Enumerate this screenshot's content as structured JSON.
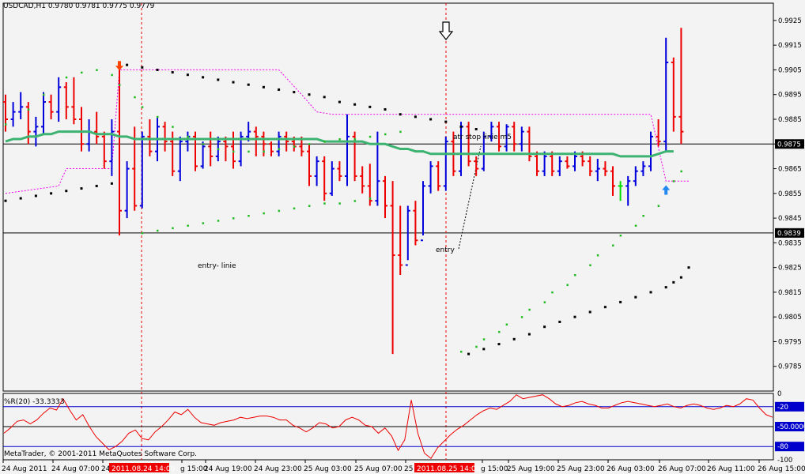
{
  "colors": {
    "background": "#f3f3f3",
    "bull_bar": "#0000dd",
    "bear_bar": "#ee0000",
    "doji_bar": "#00dd00",
    "moving_average": "#3cb371",
    "psar_green": "#22bb22",
    "psar_black": "#000000",
    "atr_stop": "#ee00ee",
    "wpr_line": "#ee0000",
    "wpr_levels": "#0000cc",
    "price_marker_bg": "#000000",
    "time_marker_bg": "#ee0000",
    "up_arrow": "#2288ee",
    "down_arrow": "#ff4400"
  },
  "header": {
    "symbol_info": "USDCAD,H1  0.9780 0.9781 0.9775 0.9779"
  },
  "annotations": {
    "atr_label": "atr stop linie m5",
    "entry_line_label": "entry- linie",
    "entry_label": "entry"
  },
  "indicator": {
    "label": "%R(20) -33.3333"
  },
  "footer": {
    "copyright": "MetaTrader, © 2001-2011 MetaQuotes Software Corp."
  },
  "price_axis": {
    "ticks": [
      "0.9925",
      "0.9915",
      "0.9905",
      "0.9895",
      "0.9885",
      "0.9875",
      "0.9865",
      "0.9855",
      "0.9845",
      "0.9835",
      "0.9825",
      "0.9815",
      "0.9805",
      "0.9795",
      "0.9785"
    ],
    "markers": [
      "0.9875",
      "0.9839"
    ]
  },
  "indicator_axis": {
    "ticks": [
      "0",
      "-20",
      "-50.0000",
      "-80",
      "-100"
    ],
    "markers": [
      "-20",
      "-50.0000",
      "-80"
    ]
  },
  "time_axis": {
    "labels": [
      "24 Aug 2011",
      "24 Aug 07:00",
      "24",
      "g 15:00",
      "24 Aug 19:00",
      "24 Aug 23:00",
      "25 Aug 03:00",
      "25 Aug 07:00",
      "25",
      "g 15:00",
      "25 Aug 19:00",
      "25 Aug 23:00",
      "26 Aug 03:00",
      "26 Aug 07:00",
      "26 Aug 11:00",
      "26 Aug 15:00"
    ],
    "highlighted": [
      "2011.08.24 14:00",
      "2011.08.25 14:00"
    ]
  },
  "chart_data": {
    "type": "bar",
    "symbol": "USDCAD",
    "timeframe": "H1",
    "ylim": [
      0.9775,
      0.9932
    ],
    "horizontal_lines": [
      0.9875,
      0.9839
    ],
    "candles": [
      [
        0.9892,
        0.9895,
        0.988,
        0.9885
      ],
      [
        0.9885,
        0.9892,
        0.9882,
        0.9888
      ],
      [
        0.9888,
        0.9896,
        0.9885,
        0.989
      ],
      [
        0.989,
        0.9892,
        0.9875,
        0.988
      ],
      [
        0.988,
        0.9886,
        0.9874,
        0.9882
      ],
      [
        0.9882,
        0.9896,
        0.9879,
        0.9892
      ],
      [
        0.9892,
        0.9895,
        0.9885,
        0.9888
      ],
      [
        0.9888,
        0.9902,
        0.9884,
        0.9898
      ],
      [
        0.9898,
        0.99,
        0.9885,
        0.989
      ],
      [
        0.989,
        0.9902,
        0.9883,
        0.9885
      ],
      [
        0.9885,
        0.989,
        0.9872,
        0.9875
      ],
      [
        0.9875,
        0.9885,
        0.9872,
        0.988
      ],
      [
        0.988,
        0.9888,
        0.9875,
        0.9878
      ],
      [
        0.9878,
        0.988,
        0.9865,
        0.9868
      ],
      [
        0.9868,
        0.9885,
        0.9862,
        0.988
      ],
      [
        0.988,
        0.9906,
        0.9838,
        0.9848
      ],
      [
        0.9848,
        0.9868,
        0.9845,
        0.9865
      ],
      [
        0.9865,
        0.9882,
        0.9848,
        0.985
      ],
      [
        0.985,
        0.988,
        0.9849,
        0.9878
      ],
      [
        0.9878,
        0.9885,
        0.987,
        0.9872
      ],
      [
        0.9872,
        0.9886,
        0.9868,
        0.9882
      ],
      [
        0.9882,
        0.9884,
        0.9872,
        0.9876
      ],
      [
        0.9876,
        0.988,
        0.9862,
        0.9864
      ],
      [
        0.9864,
        0.9878,
        0.986,
        0.9876
      ],
      [
        0.9876,
        0.988,
        0.9872,
        0.9878
      ],
      [
        0.9878,
        0.988,
        0.9864,
        0.9866
      ],
      [
        0.9866,
        0.9876,
        0.9865,
        0.9874
      ],
      [
        0.9874,
        0.988,
        0.9866,
        0.987
      ],
      [
        0.987,
        0.9878,
        0.9868,
        0.9876
      ],
      [
        0.9876,
        0.9878,
        0.9868,
        0.9874
      ],
      [
        0.9874,
        0.988,
        0.9865,
        0.9868
      ],
      [
        0.9868,
        0.988,
        0.9866,
        0.9878
      ],
      [
        0.9878,
        0.9884,
        0.9876,
        0.988
      ],
      [
        0.988,
        0.9882,
        0.987,
        0.9878
      ],
      [
        0.9878,
        0.988,
        0.987,
        0.9875
      ],
      [
        0.9875,
        0.9876,
        0.987,
        0.9872
      ],
      [
        0.9872,
        0.988,
        0.987,
        0.9878
      ],
      [
        0.9878,
        0.988,
        0.9872,
        0.9876
      ],
      [
        0.9876,
        0.9878,
        0.9872,
        0.9874
      ],
      [
        0.9874,
        0.9878,
        0.987,
        0.9872
      ],
      [
        0.9872,
        0.9875,
        0.9858,
        0.9862
      ],
      [
        0.9862,
        0.987,
        0.9858,
        0.9868
      ],
      [
        0.9868,
        0.987,
        0.9852,
        0.9855
      ],
      [
        0.9855,
        0.9868,
        0.9854,
        0.9865
      ],
      [
        0.9865,
        0.9868,
        0.986,
        0.9862
      ],
      [
        0.9862,
        0.9887,
        0.9858,
        0.9878
      ],
      [
        0.9878,
        0.988,
        0.986,
        0.9862
      ],
      [
        0.9862,
        0.9866,
        0.9855,
        0.9858
      ],
      [
        0.9858,
        0.9867,
        0.985,
        0.9852
      ],
      [
        0.9852,
        0.988,
        0.985,
        0.986
      ],
      [
        0.986,
        0.9862,
        0.9845,
        0.985
      ],
      [
        0.985,
        0.986,
        0.979,
        0.983
      ],
      [
        0.983,
        0.985,
        0.9822,
        0.9826
      ],
      [
        0.9826,
        0.985,
        0.9828,
        0.9848
      ],
      [
        0.9848,
        0.9852,
        0.9834,
        0.9836
      ],
      [
        0.9836,
        0.986,
        0.9838,
        0.9858
      ],
      [
        0.9858,
        0.9868,
        0.9855,
        0.9866
      ],
      [
        0.9866,
        0.9868,
        0.9856,
        0.9858
      ],
      [
        0.9858,
        0.9878,
        0.9856,
        0.9876
      ],
      [
        0.9876,
        0.988,
        0.9862,
        0.9864
      ],
      [
        0.9864,
        0.9884,
        0.9862,
        0.9882
      ],
      [
        0.9882,
        0.9884,
        0.9866,
        0.9868
      ],
      [
        0.9868,
        0.987,
        0.9862,
        0.9865
      ],
      [
        0.9865,
        0.988,
        0.9864,
        0.9878
      ],
      [
        0.9878,
        0.9884,
        0.9876,
        0.9882
      ],
      [
        0.9882,
        0.9884,
        0.9872,
        0.9874
      ],
      [
        0.9874,
        0.9883,
        0.9872,
        0.9882
      ],
      [
        0.9882,
        0.9884,
        0.9872,
        0.9875
      ],
      [
        0.9875,
        0.9882,
        0.9872,
        0.988
      ],
      [
        0.988,
        0.9882,
        0.9868,
        0.987
      ],
      [
        0.987,
        0.9872,
        0.9862,
        0.9864
      ],
      [
        0.9864,
        0.9872,
        0.9862,
        0.987
      ],
      [
        0.987,
        0.9872,
        0.9862,
        0.9864
      ],
      [
        0.9864,
        0.987,
        0.9862,
        0.9868
      ],
      [
        0.9868,
        0.987,
        0.9865,
        0.9866
      ],
      [
        0.9866,
        0.9872,
        0.9864,
        0.987
      ],
      [
        0.987,
        0.9872,
        0.9866,
        0.9868
      ],
      [
        0.9868,
        0.987,
        0.9862,
        0.9864
      ],
      [
        0.9864,
        0.9869,
        0.986,
        0.9865
      ],
      [
        0.9865,
        0.9868,
        0.9862,
        0.9864
      ],
      [
        0.9864,
        0.9866,
        0.9854,
        0.9858
      ],
      [
        0.9858,
        0.986,
        0.9852,
        0.9858
      ],
      [
        0.9858,
        0.9862,
        0.985,
        0.986
      ],
      [
        0.986,
        0.9866,
        0.9858,
        0.9864
      ],
      [
        0.9864,
        0.9868,
        0.9862,
        0.9866
      ],
      [
        0.9866,
        0.988,
        0.9864,
        0.9878
      ],
      [
        0.9878,
        0.9885,
        0.9874,
        0.9876
      ],
      [
        0.9876,
        0.9918,
        0.9872,
        0.9908
      ],
      [
        0.9908,
        0.991,
        0.988,
        0.9886
      ],
      [
        0.9886,
        0.9922,
        0.9875,
        0.988
      ]
    ],
    "moving_average": [
      0.9876,
      0.9877,
      0.9877,
      0.9878,
      0.9878,
      0.9879,
      0.9879,
      0.988,
      0.988,
      0.988,
      0.988,
      0.988,
      0.9879,
      0.9879,
      0.9879,
      0.9878,
      0.9878,
      0.9877,
      0.9877,
      0.9877,
      0.9877,
      0.9877,
      0.9877,
      0.9877,
      0.9877,
      0.9877,
      0.9877,
      0.9877,
      0.9877,
      0.9877,
      0.9877,
      0.9877,
      0.9877,
      0.9877,
      0.9877,
      0.9877,
      0.9877,
      0.9877,
      0.9877,
      0.9877,
      0.9877,
      0.9877,
      0.9876,
      0.9876,
      0.9876,
      0.9876,
      0.9876,
      0.9876,
      0.9875,
      0.9875,
      0.9875,
      0.9874,
      0.9873,
      0.9873,
      0.9872,
      0.9872,
      0.9871,
      0.9871,
      0.9871,
      0.9871,
      0.9871,
      0.9871,
      0.9871,
      0.9871,
      0.9871,
      0.9871,
      0.9871,
      0.9871,
      0.9871,
      0.9871,
      0.9871,
      0.9871,
      0.9871,
      0.9871,
      0.9871,
      0.9871,
      0.9871,
      0.9871,
      0.9871,
      0.9871,
      0.9871,
      0.987,
      0.987,
      0.987,
      0.987,
      0.987,
      0.9871,
      0.9872,
      0.9872
    ],
    "psar_green": [
      [
        0,
        0.9883
      ],
      [
        3,
        0.9889
      ],
      [
        5,
        0.9895
      ],
      [
        8,
        0.9902
      ],
      [
        10,
        0.9904
      ],
      [
        12,
        0.9905
      ],
      [
        14,
        0.9903
      ],
      [
        15,
        0.9899
      ],
      [
        17,
        0.9894
      ],
      [
        18,
        0.989
      ],
      [
        20,
        0.9886
      ],
      [
        22,
        0.9882
      ],
      [
        24,
        0.9878
      ],
      [
        26,
        0.9875
      ],
      [
        28,
        0.9873
      ],
      [
        30,
        0.9872
      ],
      [
        32,
        0.9872
      ],
      [
        34,
        0.9872
      ],
      [
        36,
        0.9873
      ],
      [
        38,
        0.9874
      ],
      [
        40,
        0.9875
      ],
      [
        42,
        0.9876
      ],
      [
        44,
        0.9877
      ],
      [
        46,
        0.9877
      ],
      [
        48,
        0.9878
      ],
      [
        50,
        0.9879
      ],
      [
        52,
        0.988
      ],
      [
        18,
        0.9839
      ],
      [
        20,
        0.984
      ],
      [
        22,
        0.9841
      ],
      [
        24,
        0.9842
      ],
      [
        26,
        0.9843
      ],
      [
        28,
        0.9844
      ],
      [
        30,
        0.9845
      ],
      [
        32,
        0.9846
      ],
      [
        34,
        0.9847
      ],
      [
        36,
        0.9848
      ],
      [
        38,
        0.9849
      ],
      [
        40,
        0.985
      ],
      [
        42,
        0.9851
      ],
      [
        44,
        0.9851
      ],
      [
        46,
        0.9852
      ],
      [
        48,
        0.9853
      ],
      [
        60,
        0.9791
      ],
      [
        62,
        0.9793
      ],
      [
        63,
        0.9796
      ],
      [
        65,
        0.9799
      ],
      [
        66,
        0.9802
      ],
      [
        68,
        0.9805
      ],
      [
        69,
        0.9808
      ],
      [
        71,
        0.9811
      ],
      [
        72,
        0.9815
      ],
      [
        74,
        0.9818
      ],
      [
        75,
        0.9822
      ],
      [
        77,
        0.9826
      ],
      [
        78,
        0.983
      ],
      [
        80,
        0.9834
      ],
      [
        81,
        0.9838
      ],
      [
        83,
        0.9842
      ],
      [
        84,
        0.9846
      ],
      [
        86,
        0.985
      ],
      [
        87,
        0.9855
      ],
      [
        88,
        0.986
      ],
      [
        89,
        0.9864
      ]
    ],
    "psar_black": [
      [
        0,
        0.9852
      ],
      [
        2,
        0.9853
      ],
      [
        4,
        0.9854
      ],
      [
        6,
        0.9855
      ],
      [
        8,
        0.9856
      ],
      [
        10,
        0.9857
      ],
      [
        12,
        0.9858
      ],
      [
        14,
        0.9859
      ],
      [
        16,
        0.9907
      ],
      [
        18,
        0.9906
      ],
      [
        20,
        0.9905
      ],
      [
        22,
        0.9904
      ],
      [
        24,
        0.9903
      ],
      [
        26,
        0.9902
      ],
      [
        28,
        0.9901
      ],
      [
        30,
        0.99
      ],
      [
        32,
        0.9899
      ],
      [
        34,
        0.9898
      ],
      [
        36,
        0.9897
      ],
      [
        38,
        0.9896
      ],
      [
        40,
        0.9895
      ],
      [
        42,
        0.9894
      ],
      [
        44,
        0.9892
      ],
      [
        46,
        0.9891
      ],
      [
        48,
        0.989
      ],
      [
        50,
        0.9889
      ],
      [
        52,
        0.9887
      ],
      [
        54,
        0.9886
      ],
      [
        56,
        0.9885
      ],
      [
        58,
        0.9884
      ],
      [
        60,
        0.9882
      ],
      [
        62,
        0.9881
      ],
      [
        61,
        0.979
      ],
      [
        63,
        0.9792
      ],
      [
        65,
        0.9794
      ],
      [
        67,
        0.9796
      ],
      [
        69,
        0.9798
      ],
      [
        71,
        0.9801
      ],
      [
        73,
        0.9803
      ],
      [
        75,
        0.9805
      ],
      [
        77,
        0.9807
      ],
      [
        79,
        0.9809
      ],
      [
        81,
        0.9811
      ],
      [
        83,
        0.9813
      ],
      [
        85,
        0.9815
      ],
      [
        87,
        0.9817
      ],
      [
        88,
        0.9819
      ],
      [
        89,
        0.9821
      ],
      [
        90,
        0.9825
      ]
    ],
    "atr_stop": [
      [
        0,
        0.9855
      ],
      [
        7,
        0.9858
      ],
      [
        8,
        0.9865
      ],
      [
        14,
        0.9865
      ],
      [
        15,
        0.9905
      ],
      [
        36,
        0.9905
      ],
      [
        39,
        0.9895
      ],
      [
        41,
        0.9888
      ],
      [
        43,
        0.9887
      ],
      [
        62,
        0.9887
      ],
      [
        76,
        0.9887
      ],
      [
        82,
        0.9887
      ],
      [
        85,
        0.9887
      ],
      [
        87,
        0.986
      ],
      [
        90,
        0.986
      ]
    ],
    "signal_arrows": [
      {
        "direction": "down",
        "bar": 15,
        "price": 0.9906
      },
      {
        "direction": "up",
        "bar": 87,
        "price": 0.9857
      }
    ],
    "williams_r": {
      "period": 20,
      "last": -33.3333,
      "levels": [
        -20,
        -50,
        -80
      ],
      "ylim": [
        -100,
        0
      ],
      "values": [
        -60,
        -52,
        -42,
        -40,
        -46,
        -40,
        -30,
        -22,
        -25,
        -8,
        -25,
        -40,
        -32,
        -50,
        -65,
        -75,
        -85,
        -80,
        -72,
        -60,
        -55,
        -68,
        -70,
        -58,
        -50,
        -40,
        -28,
        -32,
        -24,
        -36,
        -44,
        -46,
        -48,
        -44,
        -42,
        -40,
        -36,
        -38,
        -36,
        -34,
        -34,
        -36,
        -40,
        -40,
        -48,
        -52,
        -58,
        -52,
        -44,
        -46,
        -52,
        -50,
        -40,
        -36,
        -40,
        -48,
        -50,
        -60,
        -52,
        -64,
        -86,
        -70,
        -10,
        -60,
        -90,
        -98,
        -82,
        -72,
        -62,
        -54,
        -48,
        -40,
        -32,
        -26,
        -22,
        -24,
        -18,
        -12,
        -2,
        -8,
        -6,
        -4,
        -2,
        -8,
        -16,
        -20,
        -18,
        -14,
        -12,
        -16,
        -18,
        -22,
        -22,
        -18,
        -14,
        -12,
        -14,
        -16,
        -18,
        -20,
        -18,
        -16,
        -20,
        -22,
        -18,
        -16,
        -18,
        -22,
        -24,
        -22,
        -18,
        -20,
        -16,
        -8,
        -10,
        -22,
        -32,
        -36
      ]
    }
  }
}
